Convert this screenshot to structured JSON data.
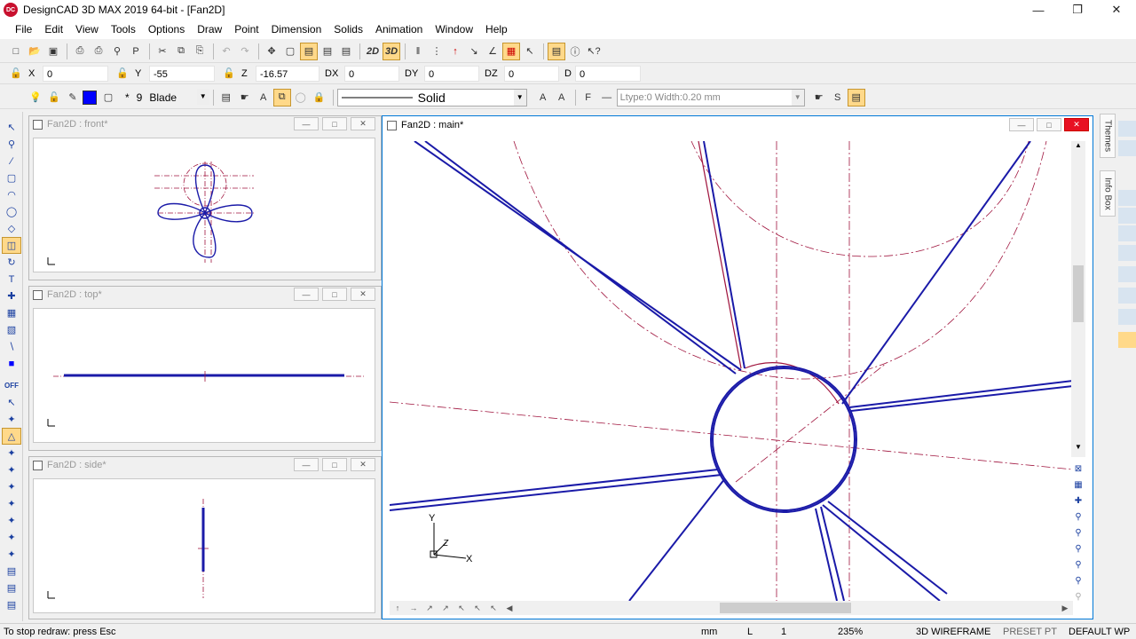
{
  "window": {
    "title": "DesignCAD 3D MAX 2019 64-bit - [Fan2D]",
    "app_badge": "DC"
  },
  "menu": [
    "File",
    "Edit",
    "View",
    "Tools",
    "Options",
    "Draw",
    "Point",
    "Dimension",
    "Solids",
    "Animation",
    "Window",
    "Help"
  ],
  "coords": {
    "x_label": "X",
    "x_value": "0",
    "y_label": "Y",
    "y_value": "-55",
    "z_label": "Z",
    "z_value": "-16.57",
    "dx_label": "DX",
    "dx_value": "0",
    "dy_label": "DY",
    "dy_value": "0",
    "dz_label": "DZ",
    "dz_value": "0",
    "d_label": "D",
    "d_value": "0"
  },
  "attributes": {
    "layer_number": "9",
    "layer_name": "Blade",
    "asterisk": "*",
    "linestyle": "Solid",
    "ltype_info": "Ltype:0  Width:0.20 mm",
    "accent_color": "#0000ff"
  },
  "toolbar": {
    "btn_2d": "2D",
    "btn_3d": "3D"
  },
  "viewports": {
    "front": {
      "title": "Fan2D : front*"
    },
    "top": {
      "title": "Fan2D : top*"
    },
    "side": {
      "title": "Fan2D : side*"
    },
    "main": {
      "title": "Fan2D : main*"
    }
  },
  "axes": {
    "x": "X",
    "y": "Y",
    "z": "Z"
  },
  "right_tabs": {
    "themes": "Themes",
    "infobox": "Info Box"
  },
  "status": {
    "message": "To stop redraw: press Esc",
    "units": "mm",
    "layer_label": "L",
    "layer_value": "1",
    "zoom": "235%",
    "render_mode": "3D WIREFRAME",
    "preset": "PRESET PT",
    "workplane": "DEFAULT WP"
  }
}
